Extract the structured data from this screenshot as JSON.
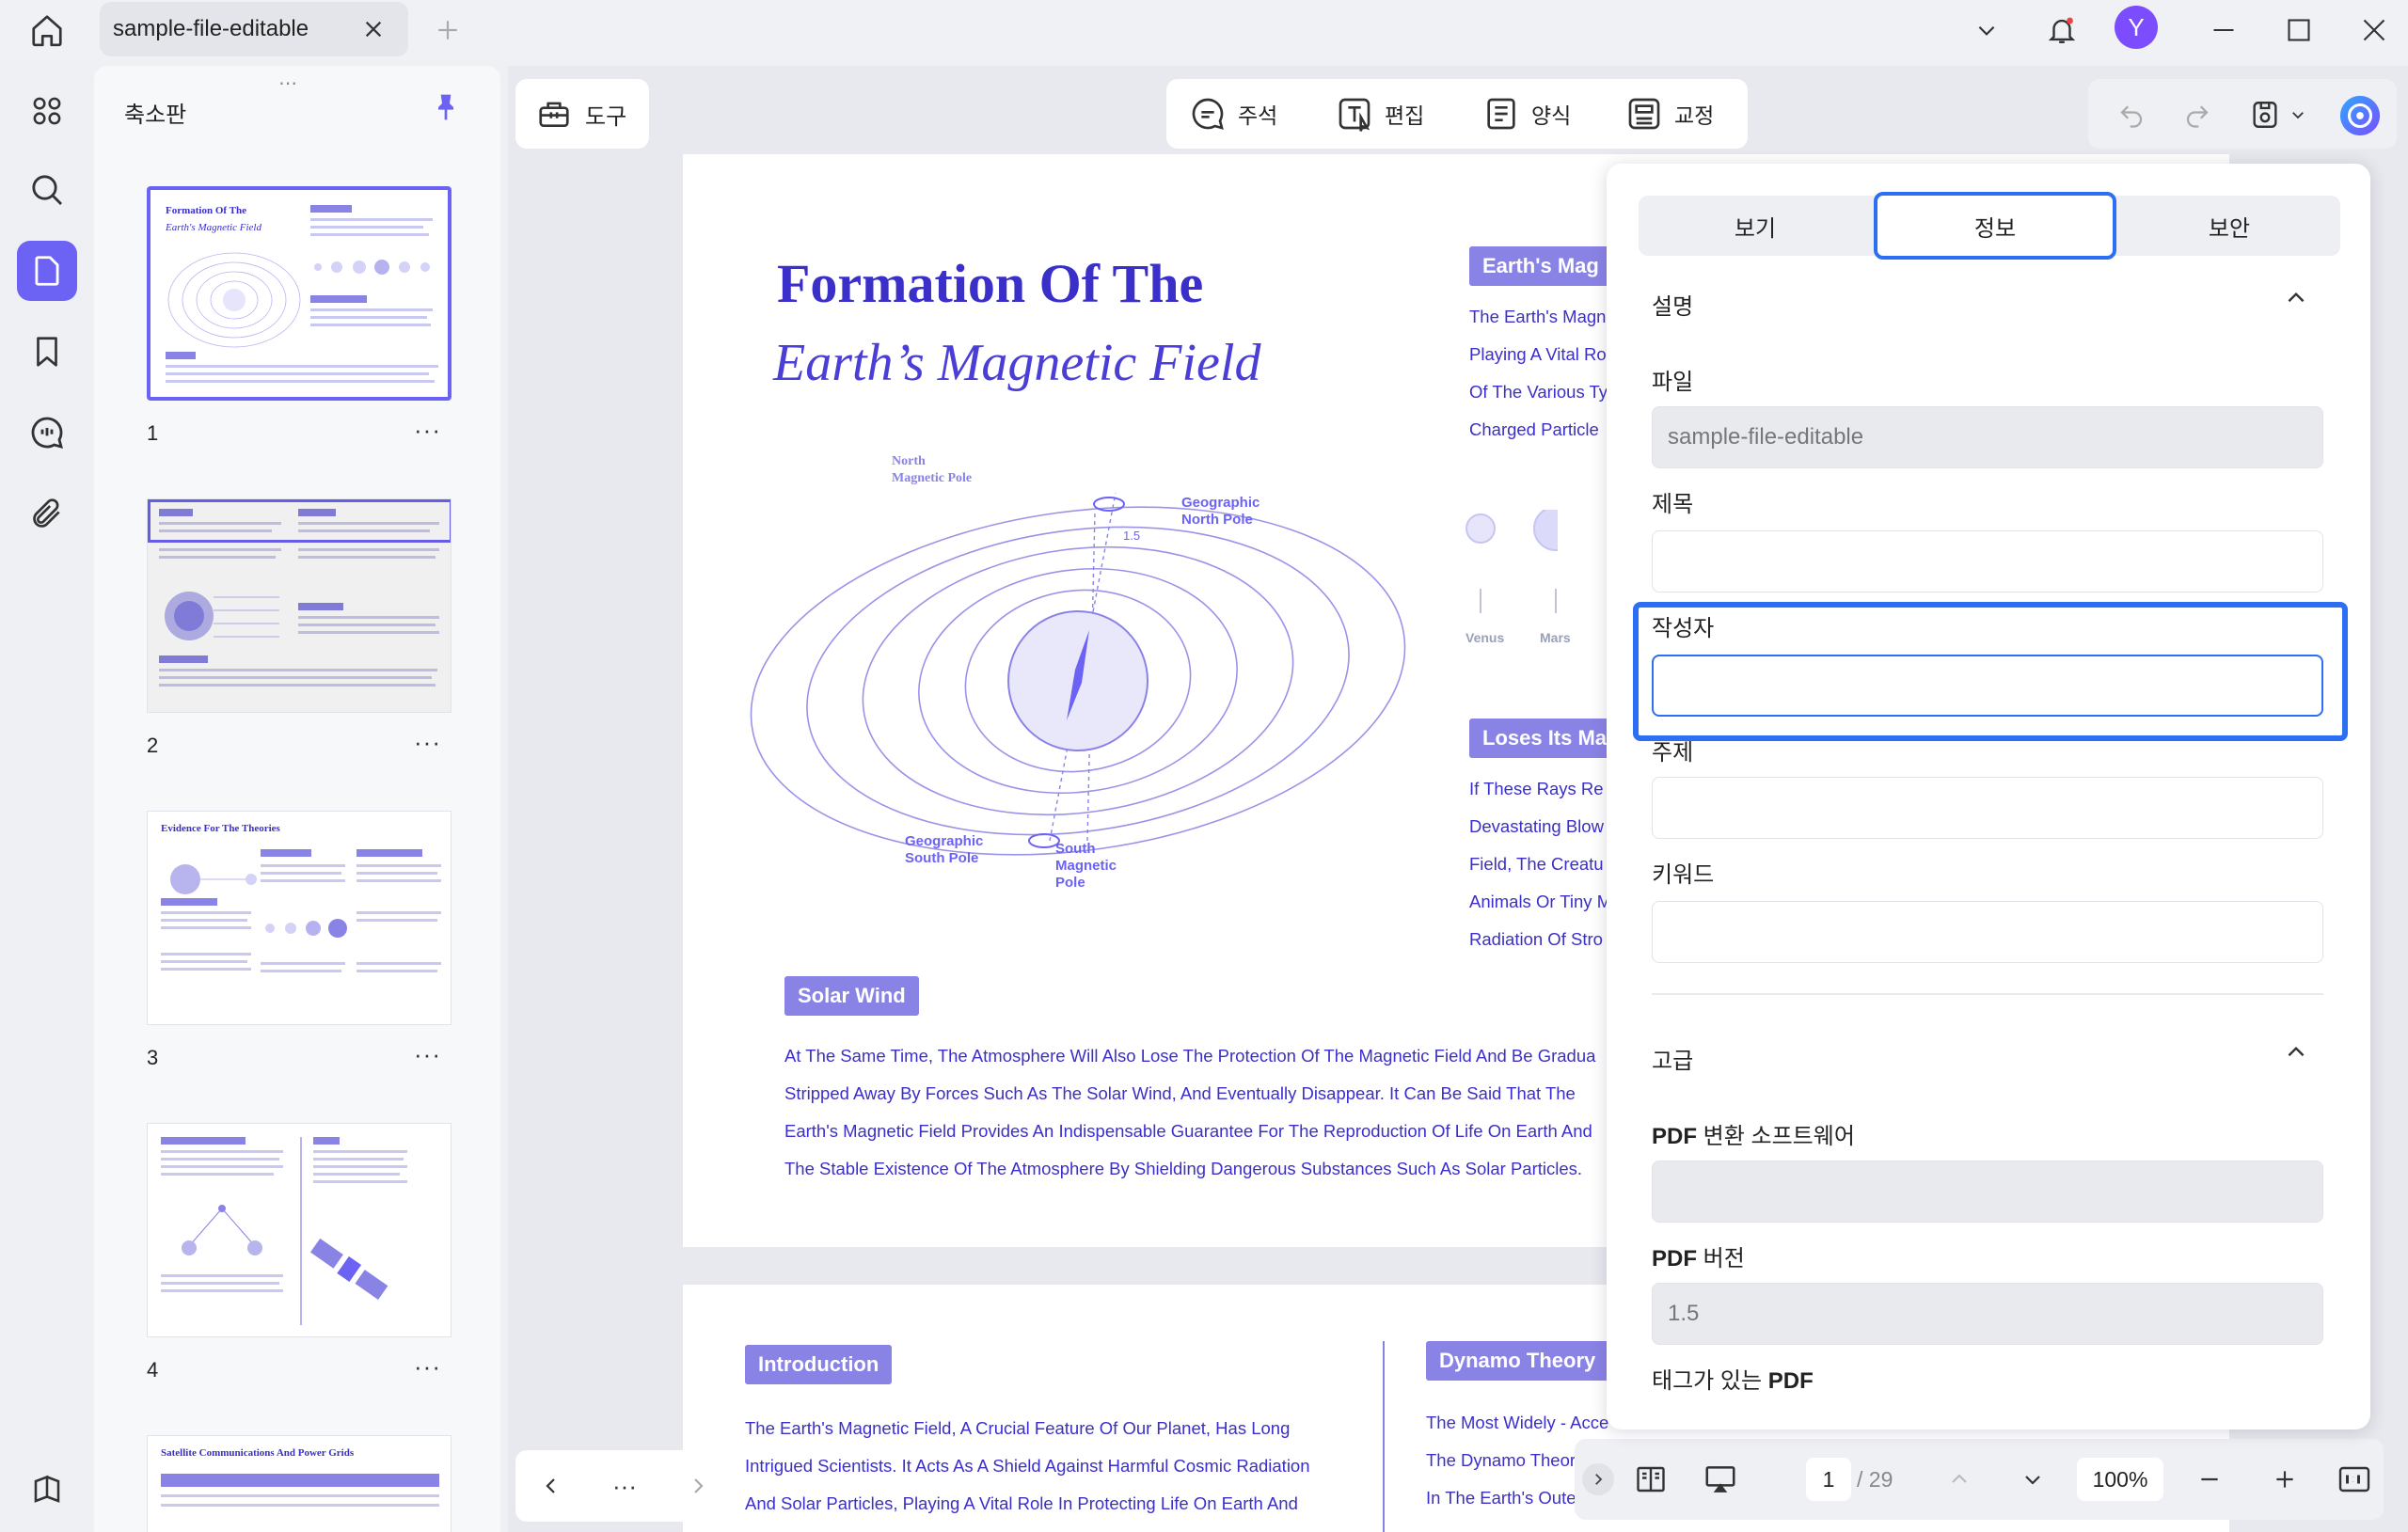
{
  "titlebar": {
    "tab_title": "sample-file-editable",
    "avatar_letter": "Y"
  },
  "thumbnails": {
    "title": "축소판",
    "pages": [
      {
        "number": "1",
        "heading": "Formation Of The",
        "subheading": "Earth's Magnetic Field"
      },
      {
        "number": "2"
      },
      {
        "number": "3",
        "heading": "Evidence For The Theories"
      },
      {
        "number": "4"
      },
      {
        "number": "",
        "heading": "Satellite Communications And Power Grids"
      }
    ],
    "more_label": "···"
  },
  "toolbar": {
    "tools_label": "도구",
    "items": [
      "주석",
      "편집",
      "양식",
      "교정"
    ]
  },
  "document": {
    "title_line1": "Formation Of The",
    "title_line2": "Earth’s Magnetic Field",
    "diagram_labels": {
      "north_magnetic": "North\nMagnetic Pole",
      "geo_north": "Geographic\nNorth Pole",
      "geo_south": "Geographic\nSouth Pole",
      "south_magnetic": "South\nMagnetic\nPole",
      "angle": "1.5"
    },
    "right_badge_1": "Earth's Mag",
    "right_lines_1": [
      "The Earth's Magn",
      "Playing A Vital Ro",
      "Of The Various Ty",
      "Charged Particle"
    ],
    "planets": [
      "Venus",
      "Mars"
    ],
    "right_badge_2": "Loses Its Mag",
    "right_lines_2": [
      "If These Rays Re",
      "Devastating Blow",
      "Field, The Creatu",
      "Animals Or Tiny M",
      "Radiation Of Stro"
    ],
    "solar_wind_badge": "Solar Wind",
    "solar_wind_lines": [
      "At The Same Time, The Atmosphere Will Also Lose The Protection Of The Magnetic Field And Be Gradua",
      "Stripped Away By Forces Such As The Solar Wind, And Eventually Disappear. It Can Be Said That The",
      "Earth's Magnetic Field Provides An Indispensable Guarantee For The Reproduction Of Life On Earth And",
      "The Stable Existence Of The Atmosphere By Shielding Dangerous Substances Such As Solar Particles."
    ],
    "intro_badge": "Introduction",
    "intro_lines": [
      "The Earth's Magnetic Field, A Crucial Feature Of Our Planet, Has Long",
      "Intrigued Scientists. It Acts As A Shield Against Harmful Cosmic Radiation",
      "And Solar Particles, Playing A Vital Role In Protecting Life On Earth And"
    ],
    "dynamo_badge": "Dynamo Theory",
    "dynamo_lines": [
      "The Most Widely - Acce",
      "The Dynamo Theor",
      "In The Earth's Oute"
    ]
  },
  "page_nav": {
    "more": "···"
  },
  "zoom_bar": {
    "current_page": "1",
    "total_pages": "/ 29",
    "zoom": "100%"
  },
  "properties": {
    "tabs": [
      "보기",
      "정보",
      "보안"
    ],
    "active_tab": "정보",
    "section_description": "설명",
    "file_label": "파일",
    "file_value": "sample-file-editable",
    "title_label": "제목",
    "title_value": "",
    "author_label": "작성자",
    "author_value": "",
    "subject_label": "주제",
    "subject_value": "",
    "keywords_label": "키워드",
    "keywords_value": "",
    "section_advanced": "고급",
    "producer_label_bold": "PDF",
    "producer_label_rest": " 변환 소프트웨어",
    "producer_value": "",
    "version_label_bold": "PDF",
    "version_label_rest": " 버전",
    "version_value": "1.5",
    "tagged_label_rest": "태그가 있는 ",
    "tagged_label_bold": "PDF"
  },
  "colors": {
    "accent": "#6c63f5",
    "focus": "#2d6ff2",
    "doc_blue": "#3b2fc9",
    "badge": "#8a83e6"
  }
}
